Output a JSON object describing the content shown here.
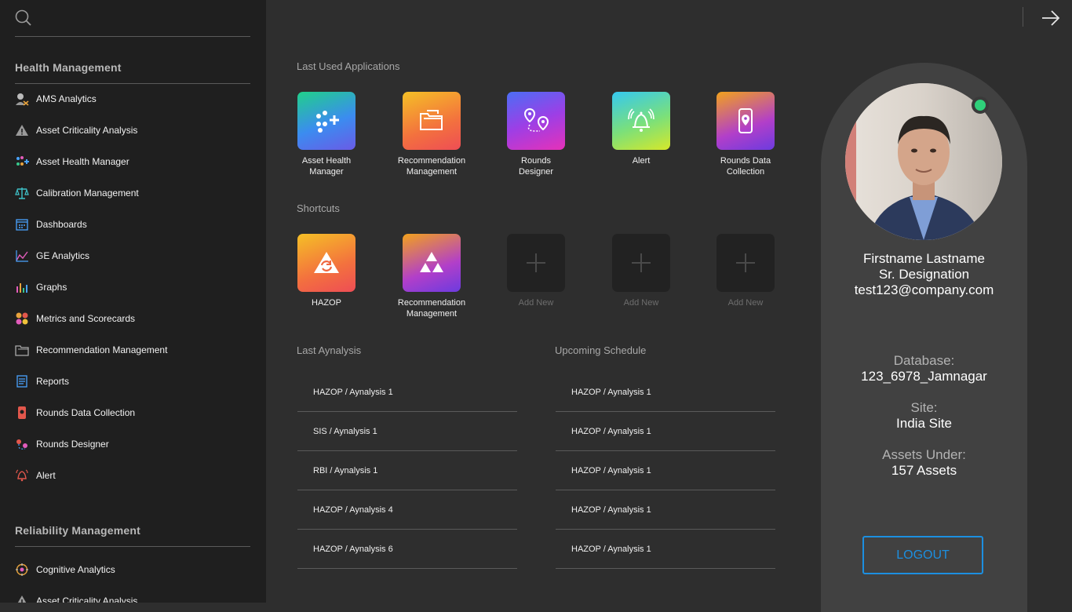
{
  "sidebar": {
    "search": {
      "placeholder": ""
    },
    "sections": [
      {
        "title": "Health Management",
        "items": [
          {
            "label": "AMS Analytics",
            "icon": "ams-analytics-icon"
          },
          {
            "label": "Asset Criticality Analysis",
            "icon": "asset-criticality-icon"
          },
          {
            "label": "Asset Health Manager",
            "icon": "asset-health-icon"
          },
          {
            "label": "Calibration Management",
            "icon": "calibration-icon"
          },
          {
            "label": "Dashboards",
            "icon": "dashboards-icon"
          },
          {
            "label": "GE Analytics",
            "icon": "ge-analytics-icon"
          },
          {
            "label": "Graphs",
            "icon": "graphs-icon"
          },
          {
            "label": "Metrics and Scorecards",
            "icon": "metrics-icon"
          },
          {
            "label": "Recommendation Management",
            "icon": "recommendation-icon"
          },
          {
            "label": "Reports",
            "icon": "reports-icon"
          },
          {
            "label": "Rounds Data Collection",
            "icon": "rounds-data-icon"
          },
          {
            "label": "Rounds Designer",
            "icon": "rounds-designer-icon"
          },
          {
            "label": "Alert",
            "icon": "alert-icon"
          }
        ]
      },
      {
        "title": "Reliability Management",
        "items": [
          {
            "label": "Cognitive Analytics",
            "icon": "cognitive-analytics-icon"
          },
          {
            "label": "Asset Criticality Analysis",
            "icon": "asset-criticality-icon"
          }
        ]
      }
    ]
  },
  "main": {
    "last_used_heading": "Last Used Applications",
    "last_used": [
      {
        "label": "Asset Health Manager",
        "line1": "Asset Health",
        "line2": "Manager",
        "icon": "asset-health-icon"
      },
      {
        "label": "Recommendation Management",
        "line1": "Recommendation",
        "line2": "Management",
        "icon": "folder-icon"
      },
      {
        "label": "Rounds Designer",
        "line1": "Rounds",
        "line2": "Designer",
        "icon": "route-pins-icon"
      },
      {
        "label": "Alert",
        "line1": "Alert",
        "line2": "",
        "icon": "bell-icon"
      },
      {
        "label": "Rounds Data Collection",
        "line1": "Rounds Data",
        "line2": "Collection",
        "icon": "phone-pin-icon"
      }
    ],
    "shortcuts_heading": "Shortcuts",
    "shortcuts": [
      {
        "line1": "HAZOP",
        "line2": "",
        "icon": "hazop-icon"
      },
      {
        "line1": "Recommendation",
        "line2": "Management",
        "icon": "triforce-icon"
      },
      {
        "line1": "Add New",
        "line2": "",
        "icon": "plus-icon"
      },
      {
        "line1": "Add New",
        "line2": "",
        "icon": "plus-icon"
      },
      {
        "line1": "Add New",
        "line2": "",
        "icon": "plus-icon"
      }
    ],
    "last_analysis_heading": "Last Aynalysis",
    "last_analysis": [
      "HAZOP / Aynalysis 1",
      "SIS / Aynalysis 1",
      "RBI / Aynalysis 1",
      "HAZOP / Aynalysis 4",
      "HAZOP / Aynalysis 6"
    ],
    "upcoming_heading": "Upcoming Schedule",
    "upcoming": [
      "HAZOP / Aynalysis 1",
      "HAZOP / Aynalysis 1",
      "HAZOP / Aynalysis 1",
      "HAZOP / Aynalysis 1",
      "HAZOP / Aynalysis 1"
    ]
  },
  "profile": {
    "name": "Firstname Lastname",
    "designation": "Sr. Designation",
    "email": "test123@company.com",
    "database_label": "Database:",
    "database_value": "123_6978_Jamnagar",
    "site_label": "Site:",
    "site_value": "India Site",
    "assets_label": "Assets Under:",
    "assets_value": "157 Assets",
    "logout_label": "LOGOUT",
    "online_color": "#2fd07a"
  },
  "colors": {
    "accent": "#1c8fe0",
    "sidebar_bg": "#1f1f1f",
    "main_bg": "#2e2e2e",
    "card_bg": "#414141"
  }
}
